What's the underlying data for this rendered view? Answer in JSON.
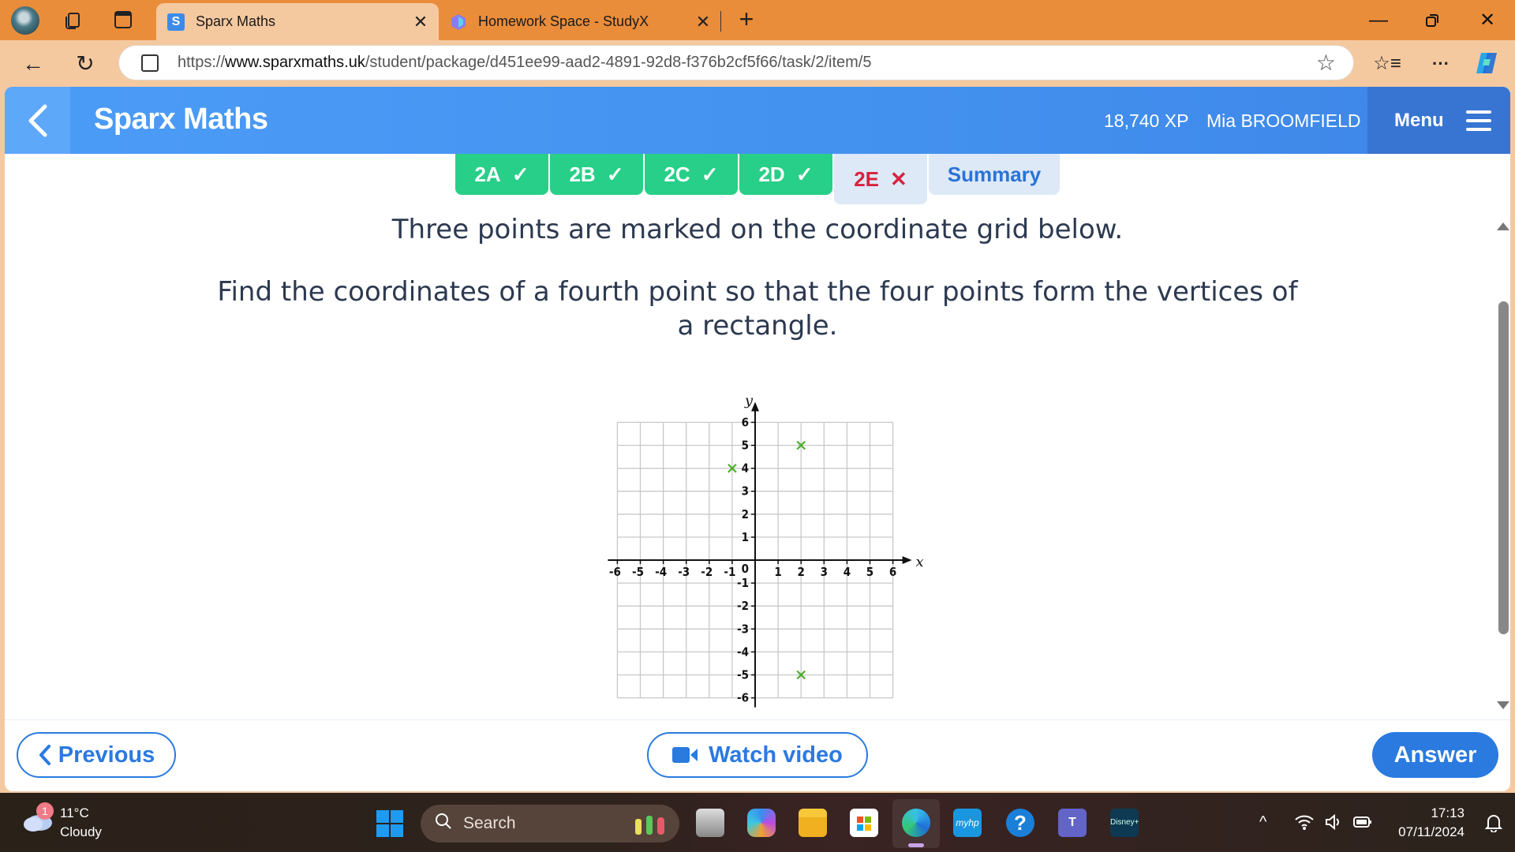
{
  "browser": {
    "tabs": [
      {
        "title": "Sparx Maths",
        "favicon": "S",
        "active": true
      },
      {
        "title": "Homework Space - StudyX",
        "favicon": "studyx-icon",
        "active": false
      }
    ],
    "url_prefix": "https://",
    "url_host": "www.sparxmaths.uk",
    "url_path": "/student/package/d451ee99-aad2-4891-92d8-f376b2cf5f66/task/2/item/5",
    "icons": {
      "tab_actions": "tab-actions-icon",
      "vertical_tabs": "vertical-tabs-icon",
      "new_tab": "+",
      "minimize": "—",
      "restore": "❐",
      "close": "✕",
      "back": "←",
      "refresh": "↻",
      "favorite": "☆",
      "favorites_list": "☆≡",
      "more": "···"
    }
  },
  "sparx": {
    "brand": "Sparx Maths",
    "xp": "18,740 XP",
    "username": "Mia BROOMFIELD",
    "menu_label": "Menu",
    "colors": {
      "header": "#4391ef",
      "done": "#28cf88",
      "wrong": "#d6223f",
      "accent": "#2a7ae0"
    },
    "task_tabs": [
      {
        "label": "2A",
        "status": "done",
        "mark": "✓"
      },
      {
        "label": "2B",
        "status": "done",
        "mark": "✓"
      },
      {
        "label": "2C",
        "status": "done",
        "mark": "✓"
      },
      {
        "label": "2D",
        "status": "done",
        "mark": "✓"
      },
      {
        "label": "2E",
        "status": "wrong",
        "mark": "✕"
      },
      {
        "label": "Summary",
        "status": "summary",
        "mark": ""
      }
    ],
    "question": {
      "line1": "Three points are marked on the coordinate grid below.",
      "line2": "Find the coordinates of a fourth point so that the four points form the vertices of",
      "line3": "a rectangle."
    },
    "buttons": {
      "previous": "Previous",
      "watch_video": "Watch video",
      "answer": "Answer"
    }
  },
  "chart_data": {
    "type": "scatter",
    "title": "",
    "xlabel": "x",
    "ylabel": "y",
    "xlim": [
      -6,
      6
    ],
    "ylim": [
      -6,
      6
    ],
    "grid": true,
    "x_ticks": [
      -6,
      -5,
      -4,
      -3,
      -2,
      -1,
      1,
      2,
      3,
      4,
      5,
      6
    ],
    "y_ticks": [
      -6,
      -5,
      -4,
      -3,
      -2,
      -1,
      1,
      2,
      3,
      4,
      5,
      6
    ],
    "origin_label": "0",
    "marker": "x",
    "marker_color": "#4caf2a",
    "points": [
      {
        "x": -1,
        "y": 4
      },
      {
        "x": 2,
        "y": 5
      },
      {
        "x": 2,
        "y": -5
      }
    ]
  },
  "taskbar": {
    "weather_badge": "1",
    "temperature": "11°C",
    "weather": "Cloudy",
    "search_label": "Search",
    "time": "17:13",
    "date": "07/11/2024"
  }
}
